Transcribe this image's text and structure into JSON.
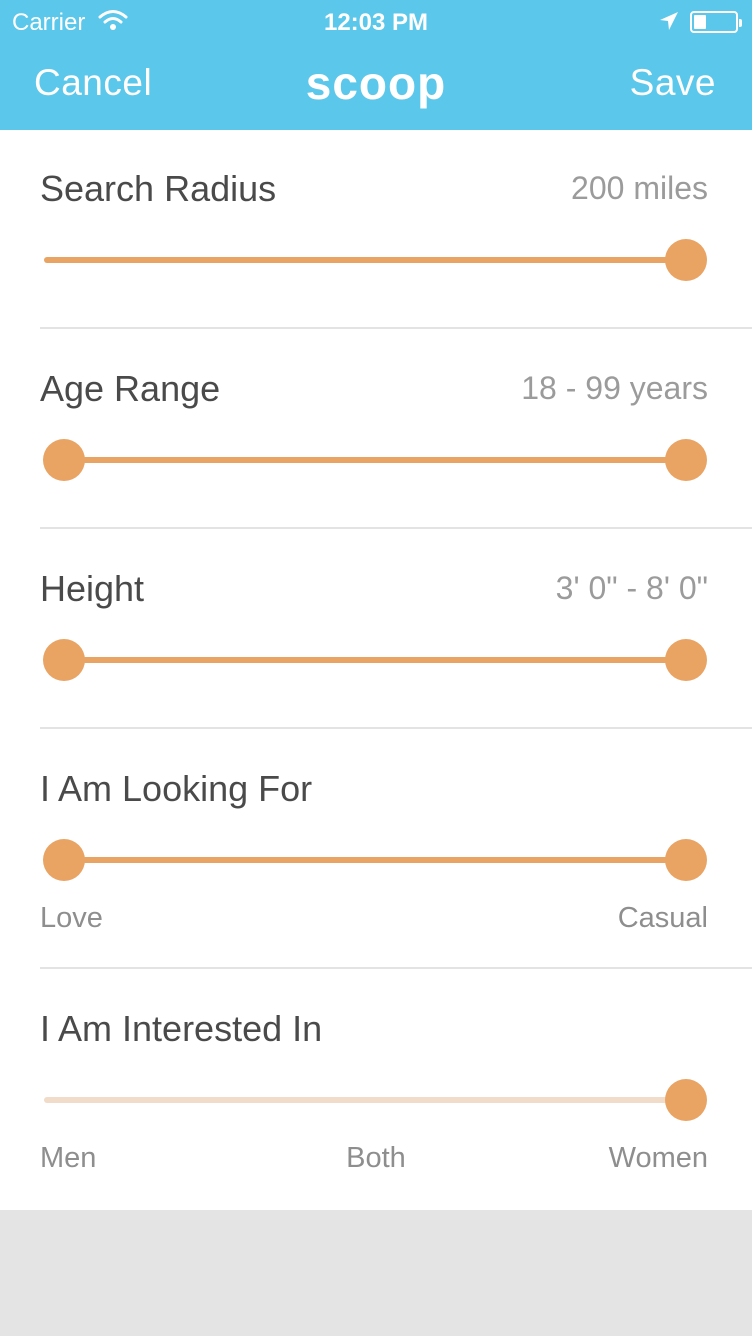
{
  "status_bar": {
    "carrier": "Carrier",
    "time": "12:03 PM"
  },
  "nav": {
    "cancel_label": "Cancel",
    "title": "scoop",
    "save_label": "Save"
  },
  "filters": {
    "search_radius": {
      "label": "Search Radius",
      "value": "200 miles",
      "level": 1.0
    },
    "age_range": {
      "label": "Age Range",
      "value": "18 - 99 years",
      "min_level": 0.0,
      "max_level": 1.0
    },
    "height": {
      "label": "Height",
      "value": "3' 0\" - 8' 0\"",
      "min_level": 0.0,
      "max_level": 1.0
    },
    "looking_for": {
      "label": "I Am Looking For",
      "min_caption": "Love",
      "max_caption": "Casual",
      "min_level": 0.0,
      "max_level": 1.0
    },
    "interested_in": {
      "label": "I Am Interested In",
      "options": [
        "Men",
        "Both",
        "Women"
      ],
      "selected": "Women",
      "level": 1.0
    }
  },
  "colors": {
    "accent": "#e9a363",
    "header": "#5bc7ea",
    "track_inactive": "#f0dcc8"
  },
  "icons": {
    "wifi": "wifi-icon",
    "location": "location-arrow-icon",
    "battery": "battery-icon"
  }
}
